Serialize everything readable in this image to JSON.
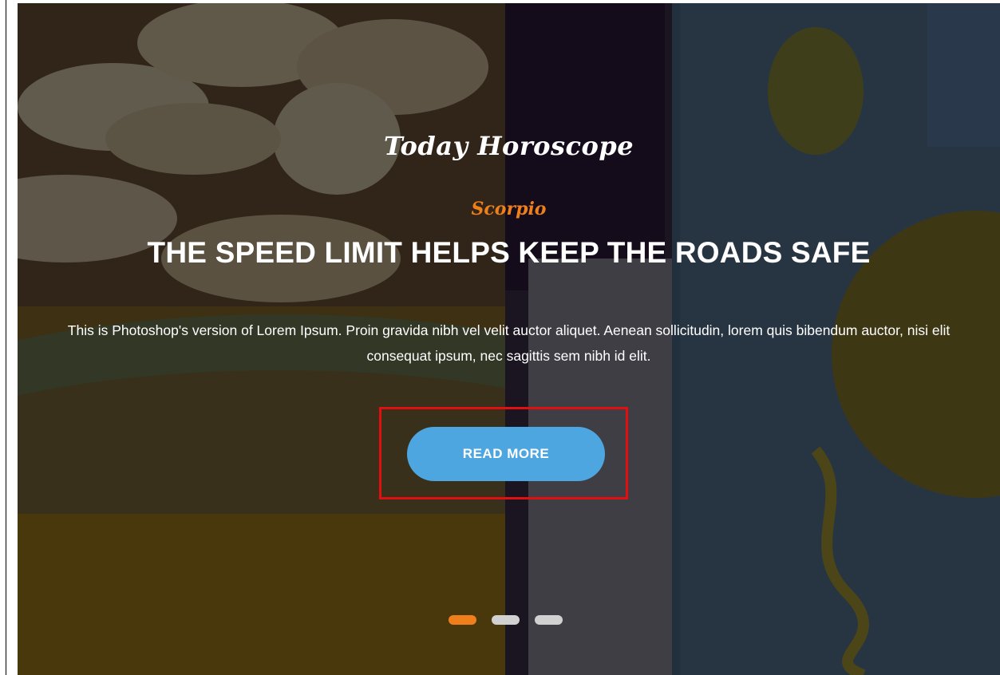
{
  "hero": {
    "section_title": "Today Horoscope",
    "sign_name": "Scorpio",
    "headline": "THE SPEED LIMIT HELPS KEEP THE ROADS SAFE",
    "description": "This is Photoshop's version of Lorem Ipsum. Proin gravida nibh vel velit auctor aliquet. Aenean sollicitudin, lorem quis bibendum auctor, nisi elit consequat ipsum, nec sagittis sem nibh id elit.",
    "cta_label": "READ MORE"
  },
  "slider": {
    "dot_count": 3,
    "active_index": 0
  },
  "colors": {
    "accent_orange": "#ef7f1a",
    "button_blue": "#4ea6e1",
    "highlight_red": "#e10f0f",
    "dot_inactive": "#d1d1d1"
  }
}
